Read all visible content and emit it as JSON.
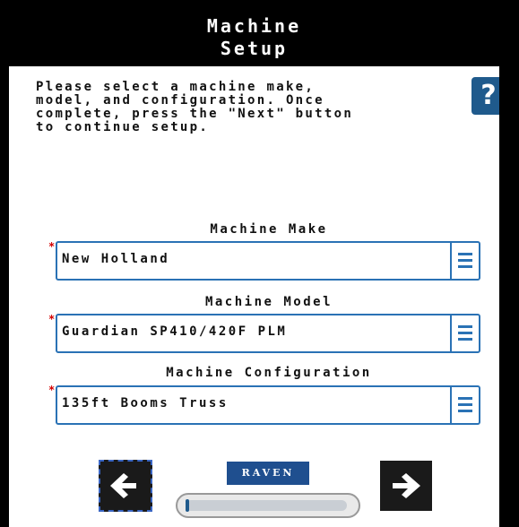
{
  "header": {
    "title_line1": "Machine",
    "title_line2": "Setup"
  },
  "instructions": "Please select a machine make,\nmodel, and configuration. Once\ncomplete, press the \"Next\" button\nto continue setup.",
  "help": {
    "label": "?",
    "icon": "help-icon"
  },
  "fields": [
    {
      "label": "Machine Make",
      "value": "New Holland",
      "required_marker": "*"
    },
    {
      "label": "Machine Model",
      "value": "Guardian SP410/420F PLM",
      "required_marker": "*"
    },
    {
      "label": "Machine Configuration",
      "value": "135ft Booms Truss",
      "required_marker": "*"
    }
  ],
  "footer": {
    "brand": "RAVEN",
    "back_icon": "arrow-left-icon",
    "next_icon": "arrow-right-icon",
    "progress": 0.02
  },
  "colors": {
    "accent": "#2a72b5",
    "brand": "#1f4f8f",
    "required": "#d40000"
  }
}
